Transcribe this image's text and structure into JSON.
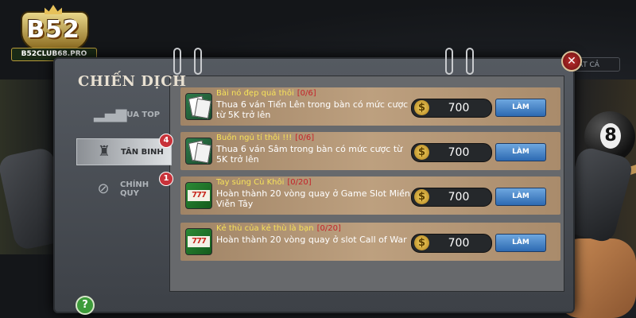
{
  "logo": {
    "brand": "B52",
    "url": "B52CLUB68.PRO"
  },
  "background": {
    "dropdown_label": "ẤT CẢ",
    "ball_number": "8"
  },
  "panel": {
    "title": "CHIẾN DỊCH",
    "close_symbol": "✕",
    "help_symbol": "?"
  },
  "tabs": [
    {
      "label": "ĐUA TOP",
      "icon": "bar-chart-icon",
      "badge": ""
    },
    {
      "label": "TÂN BINH",
      "icon": "soldier-icon",
      "badge": "4"
    },
    {
      "label": "CHÍNH QUY",
      "icon": "medal-icon",
      "badge": "1"
    }
  ],
  "missions": [
    {
      "name": "Bài nó đẹp quá thôi",
      "progress": "[0/6]",
      "description": "Thua 6 ván Tiến Lên trong bàn có mức cược từ 5K trở lên",
      "reward": "700",
      "button": "LÀM",
      "icon": "playing-cards-icon"
    },
    {
      "name": "Buồn ngủ tí thôi !!!",
      "progress": "[0/6]",
      "description": "Thua 6 ván Sâm trong bàn có mức cược từ 5K trở lên",
      "reward": "700",
      "button": "LÀM",
      "icon": "playing-cards-icon"
    },
    {
      "name": "Tay súng Cù Khôi",
      "progress": "[0/20]",
      "description": "Hoàn thành 20 vòng quay ở Game Slot Miền Viễn Tây",
      "reward": "700",
      "button": "LÀM",
      "icon": "slot-777-icon"
    },
    {
      "name": "Kẻ thù của kẻ thù là bạn",
      "progress": "[0/20]",
      "description": "Hoàn thành 20 vòng quay ở slot Call of War",
      "reward": "700",
      "button": "LÀM",
      "icon": "slot-777-icon"
    }
  ],
  "coin_symbol": "$",
  "slot_symbol": "777"
}
